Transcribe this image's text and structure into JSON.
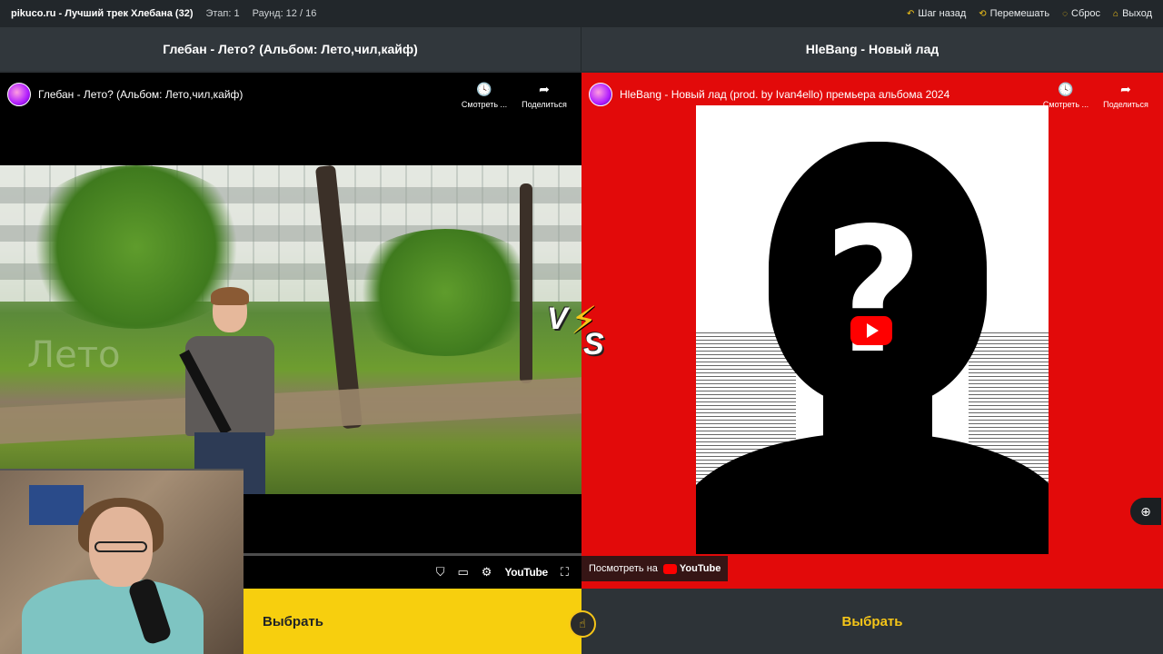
{
  "topbar": {
    "site": "pikuco.ru - Лучший трек Хлебана (32)",
    "stage": "Этап: 1",
    "round": "Раунд: 12 / 16",
    "actions": [
      {
        "label": "Шаг назад",
        "icon": "undo-icon"
      },
      {
        "label": "Перемешать",
        "icon": "shuffle-icon"
      },
      {
        "label": "Сброс",
        "icon": "reset-icon"
      },
      {
        "label": "Выход",
        "icon": "home-icon"
      }
    ]
  },
  "left": {
    "header": "Глебан - Лето? (Альбом: Лето,чил,кайф)",
    "video_title": "Глебан - Лето? (Альбом: Лето,чил,кайф)",
    "watch_later": "Смотреть ...",
    "share": "Поделиться",
    "overlay_word": "Лето",
    "youtube_word": "YouTube",
    "choose": "Выбрать"
  },
  "right": {
    "header": "HleBang - Новый лад",
    "video_title": "HleBang - Новый лад (prod. by Ivan4ello) премьера альбома 2024",
    "watch_later": "Смотреть ...",
    "share": "Поделиться",
    "watch_on": "Посмотреть на",
    "youtube_word": "YouTube",
    "choose": "Выбрать"
  },
  "colors": {
    "accent": "#f5c518",
    "red_bg": "#e20a0a",
    "dark": "#2b3034"
  }
}
